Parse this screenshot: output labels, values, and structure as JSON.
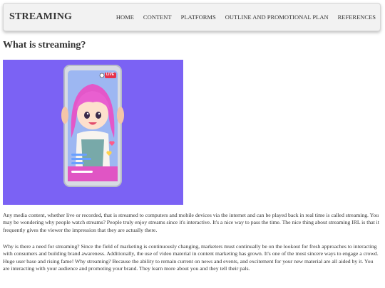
{
  "brand": "STREAMING",
  "nav": {
    "items": [
      "HOME",
      "CONTENT",
      "PLATFORMS",
      "OUTLINE AND PROMOTIONAL PLAN",
      "REFERENCES"
    ]
  },
  "main": {
    "heading": "What is streaming?",
    "hero": {
      "live_badge": "LIVE",
      "bg_color": "#7b62f4"
    },
    "paragraphs": [
      "Any media content, whether live or recorded, that is streamed to computers and mobile devices via the internet and can be played back in real time is called streaming. You may be wondering why people watch streams? People truly enjoy streams since it's interactive. It's a nice way to pass the time. The nice thing about streaming IRL is that it frequently gives the viewer the impression that they are actually there.",
      "Why is there a need for streaming? Since the field of marketing is continuously changing, marketers must continually be on the lookout for fresh approaches to interacting with consumers and building brand awareness. Additionally, the use of video material in content marketing has grown. It's one of the most sincere ways to engage a crowd. Huge user base and rising fame! Why streaming? Because the ability to remain current on news and events, and excitement for your new material are all aided by it. You are interacting with your audience and promoting your brand. They learn more about you and they tell their pals."
    ]
  }
}
